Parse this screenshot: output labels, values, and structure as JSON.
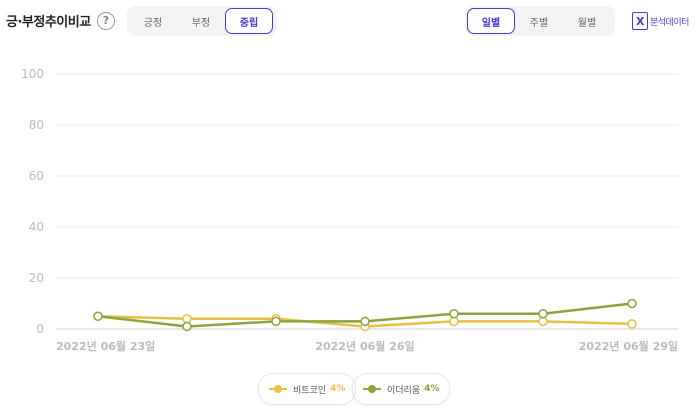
{
  "header": {
    "title": "긍·부정추이비교",
    "help_icon": "?",
    "sentiment_tabs": [
      {
        "label": "긍정",
        "active": false
      },
      {
        "label": "부정",
        "active": false
      },
      {
        "label": "중립",
        "active": true
      }
    ],
    "period_tabs": [
      {
        "label": "일별",
        "active": true
      },
      {
        "label": "주별",
        "active": false
      },
      {
        "label": "월별",
        "active": false
      }
    ],
    "analysis_link": "분석데이터",
    "analysis_icon_letter": "X"
  },
  "legend": [
    {
      "name": "비트코인",
      "pct": "4%",
      "color": "#e8c042"
    },
    {
      "name": "이더리움",
      "pct": "4%",
      "color": "#8fa33a"
    }
  ],
  "chart_data": {
    "type": "line",
    "x": [
      "2022-06-23",
      "2022-06-24",
      "2022-06-25",
      "2022-06-26",
      "2022-06-27",
      "2022-06-28",
      "2022-06-29"
    ],
    "x_tick_labels": [
      {
        "index": 0,
        "label": "2022년 06월 23일"
      },
      {
        "index": 3,
        "label": "2022년 06월 26일"
      },
      {
        "index": 6,
        "label": "2022년 06월 29일"
      }
    ],
    "ylim": [
      0,
      100
    ],
    "yticks": [
      0,
      20,
      40,
      60,
      80,
      100
    ],
    "grid": true,
    "legend_position": "bottom",
    "series": [
      {
        "name": "비트코인",
        "color": "#e8c042",
        "values": [
          5,
          4,
          4,
          1,
          3,
          3,
          2
        ]
      },
      {
        "name": "이더리움",
        "color": "#8fa33a",
        "values": [
          5,
          1,
          3,
          3,
          6,
          6,
          10
        ]
      }
    ]
  }
}
